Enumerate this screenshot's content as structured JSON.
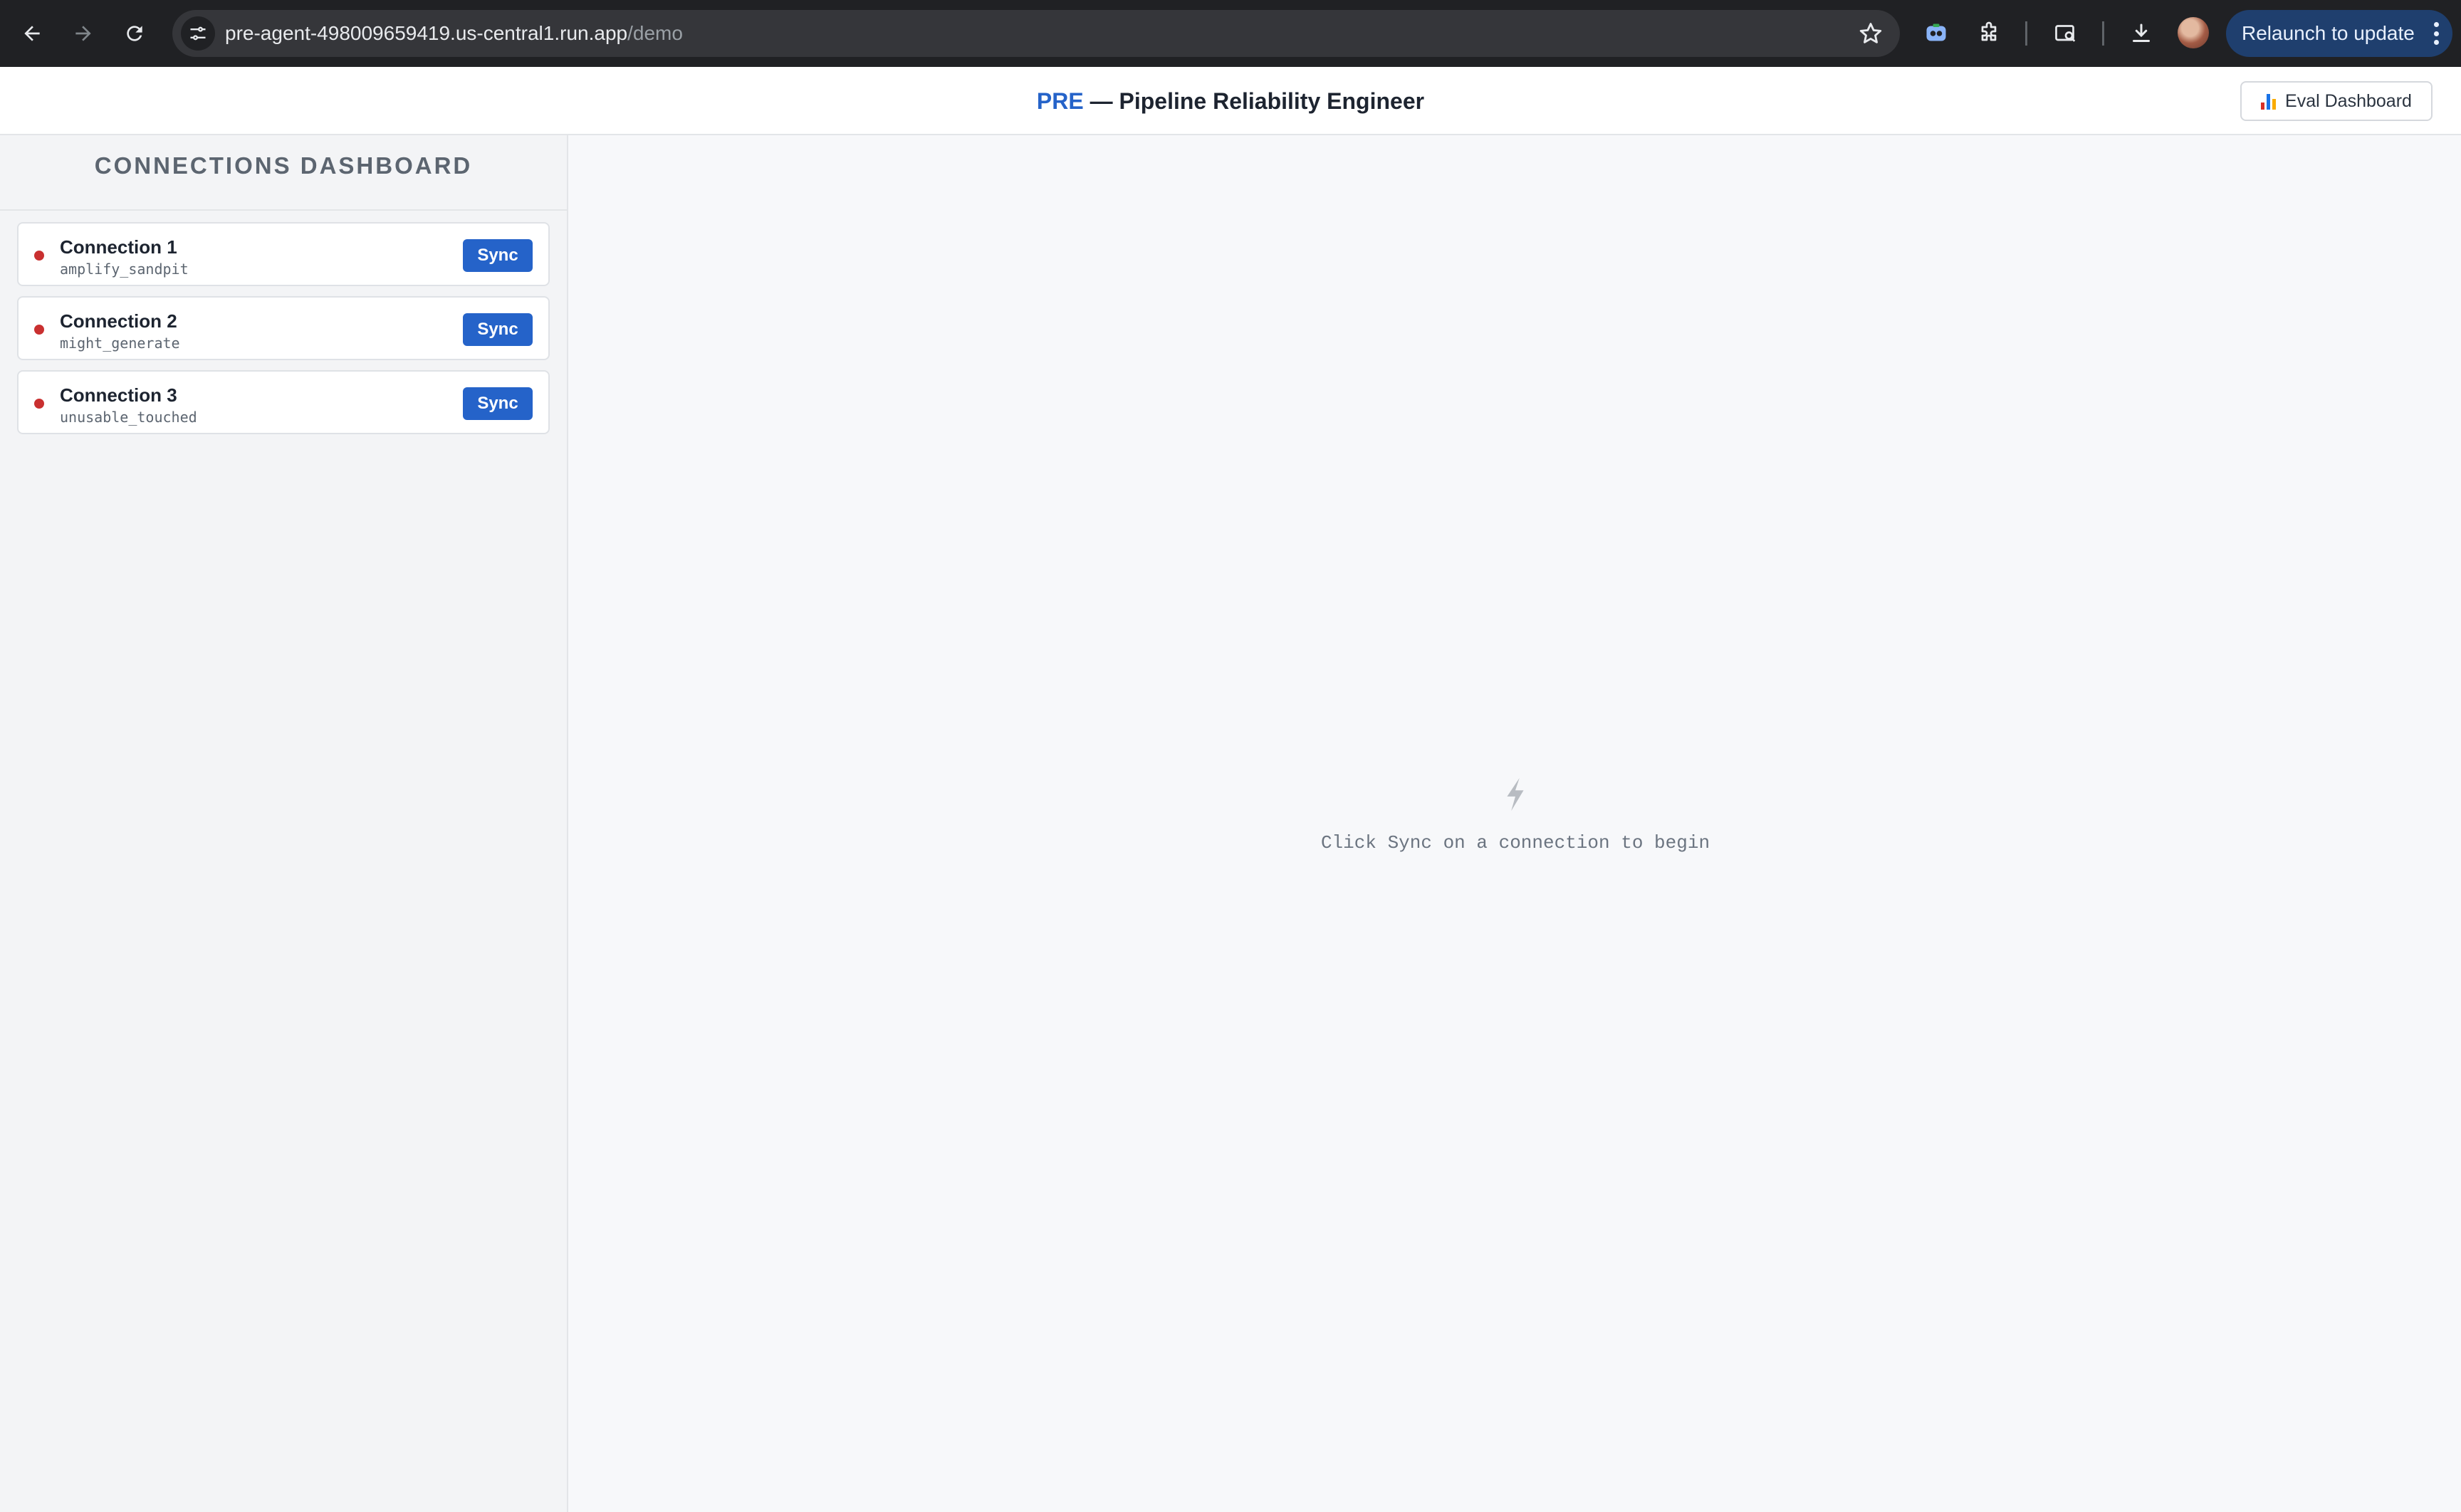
{
  "browser": {
    "url_host": "pre-agent-498009659419.us-central1.run.app",
    "url_path": "/demo",
    "relaunch_label": "Relaunch to update"
  },
  "header": {
    "brand": "PRE",
    "title_rest": " — Pipeline Reliability Engineer",
    "eval_label": "Eval Dashboard"
  },
  "sidebar": {
    "title": "CONNECTIONS DASHBOARD",
    "connections": [
      {
        "name": "Connection 1",
        "id": "amplify_sandpit",
        "status_color": "#c93030",
        "sync_label": "Sync"
      },
      {
        "name": "Connection 2",
        "id": "might_generate",
        "status_color": "#c93030",
        "sync_label": "Sync"
      },
      {
        "name": "Connection 3",
        "id": "unusable_touched",
        "status_color": "#c93030",
        "sync_label": "Sync"
      }
    ]
  },
  "main": {
    "empty_icon": "lightning-bolt-icon",
    "empty_text": "Click Sync on a connection to begin"
  },
  "colors": {
    "accent": "#2563c9",
    "status_error": "#c93030"
  }
}
